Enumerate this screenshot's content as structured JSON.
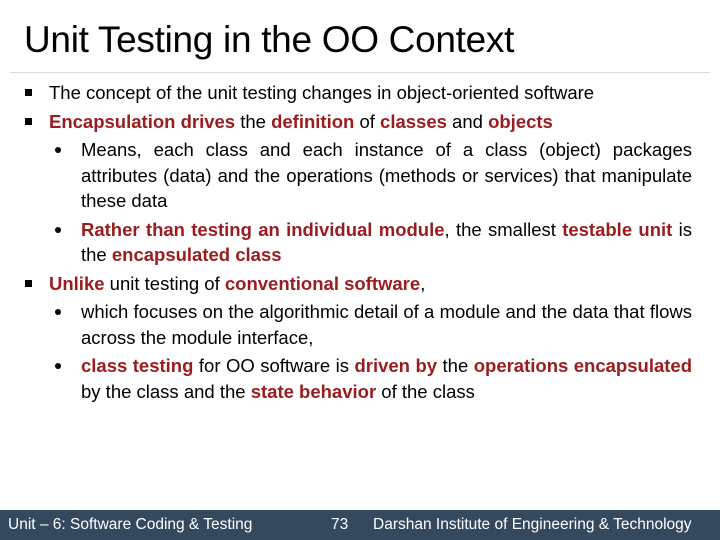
{
  "slide": {
    "title": "Unit Testing in the OO Context",
    "colors": {
      "highlight": "#9b1c1f",
      "footer_bg": "#34495e",
      "text": "#000000"
    },
    "bullets": [
      {
        "level": 1,
        "icon": "square-bullet-icon",
        "runs": [
          {
            "text": "The concept of the unit testing changes in object-oriented software",
            "highlight": false
          }
        ]
      },
      {
        "level": 1,
        "icon": "square-bullet-icon",
        "runs": [
          {
            "text": "Encapsulation drives",
            "highlight": true
          },
          {
            "text": " the ",
            "highlight": false
          },
          {
            "text": "definition",
            "highlight": true
          },
          {
            "text": " of ",
            "highlight": false
          },
          {
            "text": "classes",
            "highlight": true
          },
          {
            "text": " and ",
            "highlight": false
          },
          {
            "text": "objects",
            "highlight": true
          }
        ]
      },
      {
        "level": 2,
        "icon": "round-bullet-icon",
        "runs": [
          {
            "text": "Means, each class and each instance of a class (object) packages attributes (data) and the operations (methods or services) that manipulate these data",
            "highlight": false
          }
        ]
      },
      {
        "level": 2,
        "icon": "round-bullet-icon",
        "runs": [
          {
            "text": "Rather than testing an individual module",
            "highlight": true
          },
          {
            "text": ", the smallest ",
            "highlight": false
          },
          {
            "text": "testable unit",
            "highlight": true
          },
          {
            "text": " is the ",
            "highlight": false
          },
          {
            "text": "encapsulated class",
            "highlight": true
          }
        ]
      },
      {
        "level": 1,
        "icon": "square-bullet-icon",
        "runs": [
          {
            "text": "Unlike",
            "highlight": true
          },
          {
            "text": " unit testing of ",
            "highlight": false
          },
          {
            "text": "conventional software",
            "highlight": true
          },
          {
            "text": ",",
            "highlight": false
          }
        ]
      },
      {
        "level": 2,
        "icon": "round-bullet-icon",
        "runs": [
          {
            "text": "which focuses on the algorithmic detail of a module and the data that flows across the module interface,",
            "highlight": false
          }
        ]
      },
      {
        "level": 2,
        "icon": "round-bullet-icon",
        "runs": [
          {
            "text": "class testing",
            "highlight": true
          },
          {
            "text": " for OO software is ",
            "highlight": false
          },
          {
            "text": "driven by",
            "highlight": true
          },
          {
            "text": " the ",
            "highlight": false
          },
          {
            "text": "operations encapsulated",
            "highlight": true
          },
          {
            "text": " by the class and the ",
            "highlight": false
          },
          {
            "text": "state behavior",
            "highlight": true
          },
          {
            "text": " of the class",
            "highlight": false
          }
        ]
      }
    ]
  },
  "footer": {
    "unit": "Unit – 6: Software Coding & Testing",
    "page_number": "73",
    "institute": "Darshan Institute of Engineering & Technology"
  }
}
